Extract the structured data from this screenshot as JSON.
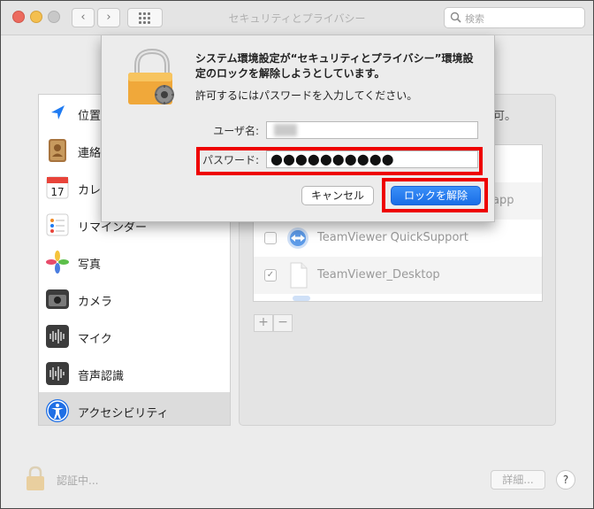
{
  "window": {
    "title": "セキュリティとプライバシー"
  },
  "toolbar": {
    "back": "‹",
    "forward": "›",
    "search_placeholder": "検索"
  },
  "sidebar": {
    "items": [
      {
        "label": "位置情報サービス",
        "icon": "location-arrow-icon"
      },
      {
        "label": "連絡先",
        "icon": "contacts-icon"
      },
      {
        "label": "カレンダー",
        "icon": "calendar-icon"
      },
      {
        "label": "リマインダー",
        "icon": "reminders-icon"
      },
      {
        "label": "写真",
        "icon": "photos-icon"
      },
      {
        "label": "カメラ",
        "icon": "camera-icon"
      },
      {
        "label": "マイク",
        "icon": "microphone-icon"
      },
      {
        "label": "音声認識",
        "icon": "speech-recognition-icon"
      },
      {
        "label": "アクセシビリティ",
        "icon": "accessibility-icon",
        "selected": true
      }
    ]
  },
  "right_panel": {
    "caption_tail": "可。",
    "apps": [
      {
        "label": "",
        "checked": false
      },
      {
        "label": "app",
        "checked": false
      },
      {
        "label": "TeamViewer QuickSupport",
        "checked": false
      },
      {
        "label": "TeamViewer_Desktop",
        "checked": true
      }
    ],
    "add": "+",
    "remove": "−",
    "checkmark": "✓"
  },
  "footer": {
    "status": "認証中...",
    "advanced": "詳細...",
    "help": "?"
  },
  "dialog": {
    "title": "システム環境設定が“セキュリティとプライバシー”環境設定のロックを解除しようとしています。",
    "subtitle": "許可するにはパスワードを入力してください。",
    "username_label": "ユーザ名:",
    "password_label": "パスワード:",
    "password_value": "●●●●●●●●●●",
    "cancel_label": "キャンセル",
    "unlock_label": "ロックを解除"
  },
  "colors": {
    "accent": "#1a6ee6",
    "highlight": "#ee0000"
  }
}
